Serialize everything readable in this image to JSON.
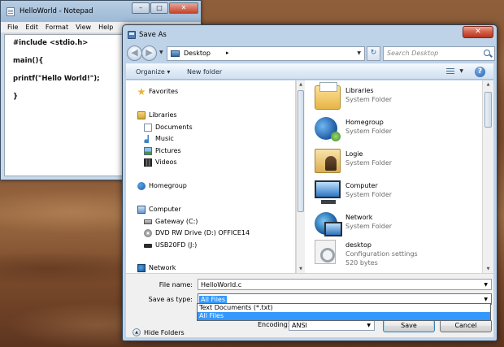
{
  "notepad": {
    "title": "HelloWorld - Notepad",
    "window_controls": [
      "–",
      "□",
      "✕"
    ],
    "menu": [
      "File",
      "Edit",
      "Format",
      "View",
      "Help"
    ],
    "lines": [
      "#include <stdio.h>",
      "main(){",
      "printf(\"Hello World!\");",
      "}"
    ]
  },
  "dialog": {
    "title": "Save As",
    "close_glyph": "✕",
    "address": {
      "location": "Desktop",
      "separator": "▸"
    },
    "search_placeholder": "Search Desktop",
    "toolbar": {
      "organize": "Organize ▾",
      "new_folder": "New folder",
      "help_glyph": "?"
    },
    "nav": {
      "favorites": "Favorites",
      "libraries": "Libraries",
      "documents": "Documents",
      "music": "Music",
      "pictures": "Pictures",
      "videos": "Videos",
      "homegroup": "Homegroup",
      "computer": "Computer",
      "gateway": "Gateway (C:)",
      "dvd": "DVD RW Drive (D:) OFFICE14",
      "usb": "USB20FD (J:)",
      "network": "Network"
    },
    "files": [
      {
        "name": "Libraries",
        "type": "System Folder",
        "icon": "libraries-icon"
      },
      {
        "name": "Homegroup",
        "type": "System Folder",
        "icon": "homegroup-icon"
      },
      {
        "name": "Logie",
        "type": "System Folder",
        "icon": "user-folder-icon"
      },
      {
        "name": "Computer",
        "type": "System Folder",
        "icon": "computer-icon"
      },
      {
        "name": "Network",
        "type": "System Folder",
        "icon": "network-icon"
      },
      {
        "name": "desktop",
        "type": "Configuration settings",
        "size": "520 bytes",
        "icon": "config-file-icon"
      }
    ],
    "file_name_label": "File name:",
    "file_name_value": "HelloWorld.c",
    "save_type_label": "Save as type:",
    "save_type_value": "All Files",
    "save_type_options": [
      "Text Documents (*.txt)",
      "All Files"
    ],
    "hide_folders": "Hide Folders",
    "encoding_label": "Encoding:",
    "encoding_value": "ANSI",
    "save_button": "Save",
    "cancel_button": "Cancel"
  }
}
